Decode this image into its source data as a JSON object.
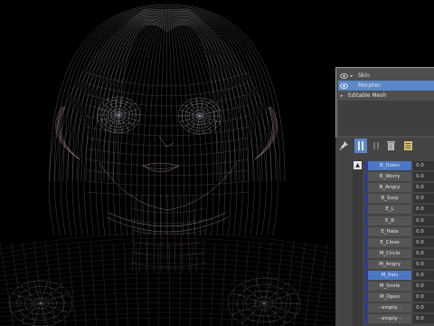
{
  "colors": {
    "wire_light": "#d8d6e6",
    "wire_pink": "#b48a94",
    "selected": "#5a88c8",
    "indicator": "#1c39c8"
  },
  "modifier_stack": {
    "items": [
      {
        "label": "Skin",
        "has_eye": true,
        "has_arrow": true,
        "selected": false
      },
      {
        "label": "Morpher",
        "has_eye": true,
        "has_arrow": false,
        "selected": true
      },
      {
        "label": "Editable Mesh",
        "has_eye": false,
        "has_arrow": true,
        "selected": false
      }
    ]
  },
  "toolbar": {
    "icons": [
      "pin-stack-icon",
      "show-end-result-icon",
      "make-unique-icon",
      "remove-modifier-icon",
      "configure-sets-icon"
    ]
  },
  "morph_channels": [
    {
      "name": "B_Down",
      "value": "0.0",
      "active": true
    },
    {
      "name": "B_Worry",
      "value": "0.0",
      "active": false
    },
    {
      "name": "B_Angry",
      "value": "0.0",
      "active": false
    },
    {
      "name": "B_Surp",
      "value": "0.0",
      "active": false
    },
    {
      "name": "E_L",
      "value": "0.0",
      "active": false
    },
    {
      "name": "E_R",
      "value": "0.0",
      "active": false
    },
    {
      "name": "E_Hate",
      "value": "0.0",
      "active": false
    },
    {
      "name": "E_Close",
      "value": "0.0",
      "active": false
    },
    {
      "name": "M_Circle",
      "value": "0.0",
      "active": false
    },
    {
      "name": "M_Angry",
      "value": "0.0",
      "active": false
    },
    {
      "name": "M_Pain",
      "value": "0.0",
      "active": true
    },
    {
      "name": "M_Smile",
      "value": "0.0",
      "active": false
    },
    {
      "name": "M_Open",
      "value": "0.0",
      "active": false
    },
    {
      "name": "- empty -",
      "value": "0.0",
      "active": false
    },
    {
      "name": "- empty -",
      "value": "0.0",
      "active": false
    }
  ]
}
